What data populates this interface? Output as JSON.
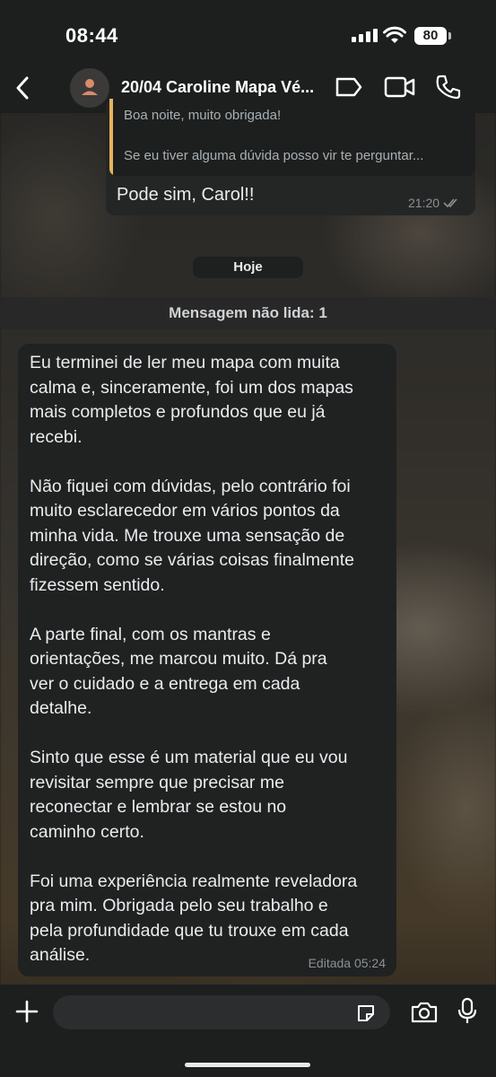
{
  "status_bar": {
    "time": "08:44",
    "battery": "80"
  },
  "header": {
    "contact_name": "20/04 Caroline Mapa Vé..."
  },
  "quoted": {
    "line1": "Boa noite, muito obrigada!",
    "line2": "Se eu tiver alguma dúvida posso vir te perguntar..."
  },
  "reply": {
    "text": "Pode sim, Carol!!",
    "time": "21:20"
  },
  "date_chip": "Hoje",
  "unread_banner": "Mensagem não lida: 1",
  "incoming": {
    "paragraphs": [
      "Eu terminei de ler meu mapa com muita\ncalma e, sinceramente, foi um dos mapas\nmais completos e profundos que eu já\nrecebi.",
      "Não fiquei com dúvidas, pelo contrário foi\nmuito esclarecedor em vários pontos da\nminha vida. Me trouxe uma sensação de\ndireção, como se várias coisas finalmente\nfizessem sentido.",
      "A parte final, com os mantras e\norientações, me marcou muito. Dá pra\nver o cuidado e a entrega em cada\ndetalhe.",
      "Sinto que esse é um material que eu vou\nrevisitar sempre que precisar me\nreconectar e lembrar se estou no\ncaminho certo.",
      "Foi uma experiência realmente reveladora\npra mim. Obrigada pelo seu trabalho e\npela profundidade que tu trouxe em cada\nanálise."
    ],
    "meta": "Editada 05:24"
  },
  "composer": {
    "value": ""
  },
  "colors": {
    "bar_bg": "#1d1f1f",
    "bubble_bg": "#202222",
    "quote_accent": "#e6b45a"
  },
  "icons": [
    "back-icon",
    "person-icon",
    "label-icon",
    "video-call-icon",
    "phone-icon",
    "plus-icon",
    "sticker-icon",
    "camera-icon",
    "mic-icon",
    "double-check-icon"
  ]
}
